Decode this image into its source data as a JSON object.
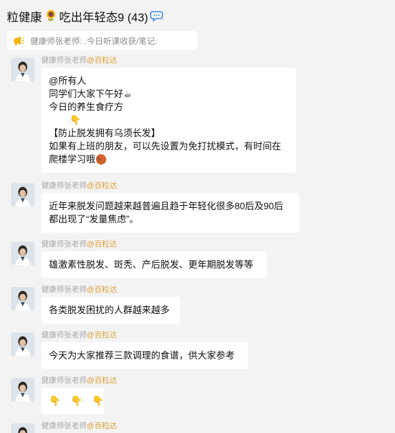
{
  "header": {
    "title_prefix": "粒健康",
    "title_emoji": "🌻",
    "title_suffix": "吃出年轻态9 (43)",
    "chat_icon": "speech-bubble-icon"
  },
  "notice": {
    "icon": "announcement-icon",
    "text": "健康师张老师: .今日听课收获/笔记:"
  },
  "messages": [
    {
      "sender_name": "健康师张老师",
      "sender_tag": "@百粒达",
      "lines": [
        "@所有人",
        "同学们大家下午好☕",
        "今日的养生食疗方",
        "👇",
        "【防止脱发拥有乌须长发】",
        "如果有上班的朋友，可以先设置为免打扰模式，有时间在",
        "爬楼学习哦🏀"
      ]
    },
    {
      "sender_name": "健康师张老师",
      "sender_tag": "@百粒达",
      "lines": [
        "近年来脱发问题越来越普遍且趋于年轻化很多80后及90后",
        "都出现了“发量焦虑”。"
      ]
    },
    {
      "sender_name": "健康师张老师",
      "sender_tag": "@百粒达",
      "lines": [
        "雄激素性脱发、斑秃、产后脱发、更年期脱发等等"
      ]
    },
    {
      "sender_name": "健康师张老师",
      "sender_tag": "@百粒达",
      "lines": [
        "各类脱发困扰的人群越来越多"
      ]
    },
    {
      "sender_name": "健康师张老师",
      "sender_tag": "@百粒达",
      "lines": [
        "今天为大家推荐三款调理的食谱，供大家参考"
      ]
    },
    {
      "sender_name": "健康师张老师",
      "sender_tag": "@百粒达",
      "hands": [
        "👇",
        "👇",
        "👇"
      ]
    },
    {
      "sender_name": "健康师张老师",
      "sender_tag": "@百粒达"
    }
  ]
}
